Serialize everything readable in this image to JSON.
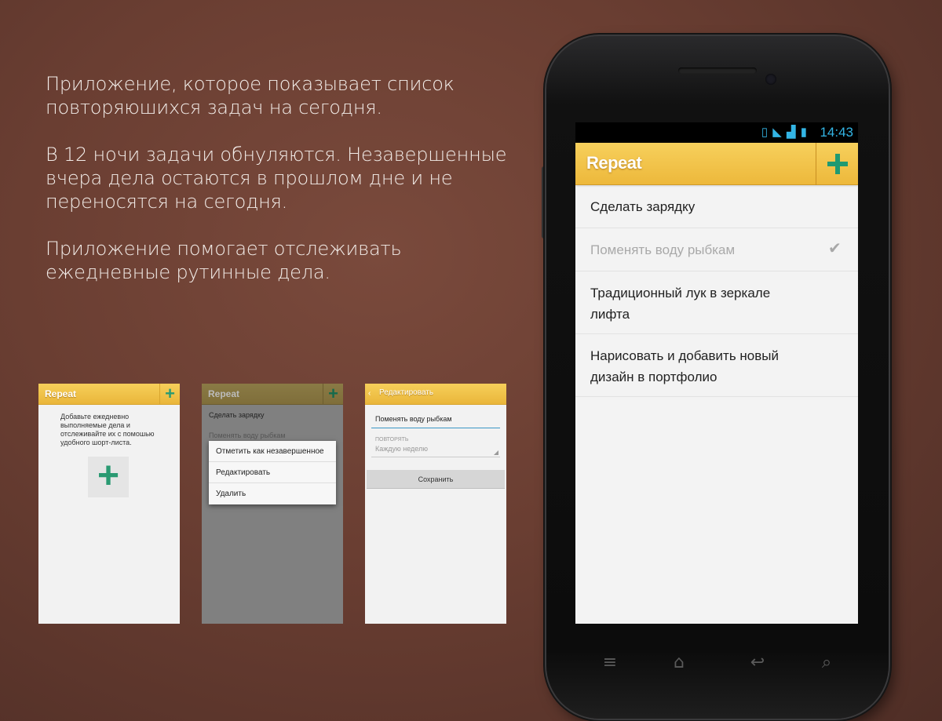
{
  "description": {
    "p1": "Приложение, которое показывает список повторяюшихся задач на сегодня.",
    "p2": "В 12 ночи задачи обнуляются. Незавершенные вчера дела остаются в прошлом дне и не переносятся на сегодня.",
    "p3": "Приложение помогает отслеживать ежедневные рутинные дела."
  },
  "app_name": "Repeat",
  "colors": {
    "accent": "#edb83b",
    "plus": "#1f9a72",
    "statusbar_text": "#33b5e5"
  },
  "statusbar": {
    "time": "14:43",
    "icons": [
      "vibrate-icon",
      "wifi-icon",
      "signal-icon",
      "battery-icon"
    ]
  },
  "tasks": [
    {
      "label": "Сделать зарядку",
      "done": false
    },
    {
      "label": "Поменять воду рыбкам",
      "done": true
    },
    {
      "label": "Традиционный лук в зеркале лифта",
      "done": false
    },
    {
      "label": "Нарисовать и добавить новый дизайн в портфолио",
      "done": false
    }
  ],
  "mini1": {
    "title": "Repeat",
    "empty_text": "Добавьте ежедневно выполняемые дела и отслеживайте их с помошью удобного шорт-листа."
  },
  "mini2": {
    "title": "Repeat",
    "row1": "Сделать зарядку",
    "row2": "Поменять воду рыбкам",
    "menu": [
      "Отметить как незавершенное",
      "Редактировать",
      "Удалить"
    ]
  },
  "mini3": {
    "title": "Редактировать",
    "input_value": "Поменять воду рыбкам",
    "repeat_label": "ПОВТОРЯТЬ",
    "repeat_value": "Каждую неделю",
    "save_label": "Сохранить"
  },
  "navbar": [
    "menu-icon",
    "home-icon",
    "back-icon",
    "search-icon"
  ]
}
